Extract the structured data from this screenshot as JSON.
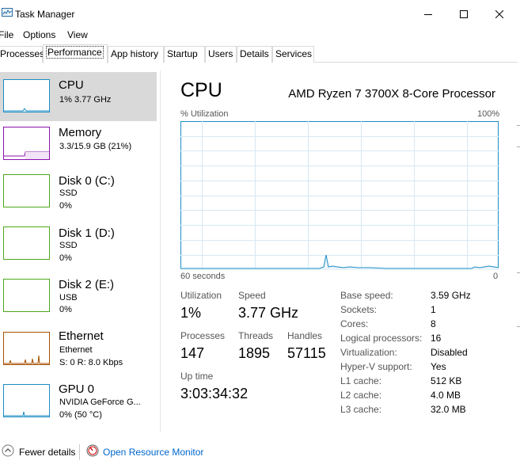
{
  "window": {
    "title": "Task Manager"
  },
  "menu": [
    "File",
    "Options",
    "View"
  ],
  "tabs": [
    "Processes",
    "Performance",
    "App history",
    "Startup",
    "Users",
    "Details",
    "Services"
  ],
  "sidebar": {
    "items": [
      {
        "title": "CPU",
        "line1": "1%  3.77 GHz",
        "line2": "",
        "color": "#1c8cc4"
      },
      {
        "title": "Memory",
        "line1": "3.3/15.9 GB (21%)",
        "line2": "",
        "color": "#8b12ae"
      },
      {
        "title": "Disk 0 (C:)",
        "line1": "SSD",
        "line2": "0%",
        "color": "#4da61b"
      },
      {
        "title": "Disk 1 (D:)",
        "line1": "SSD",
        "line2": "0%",
        "color": "#4da61b"
      },
      {
        "title": "Disk 2 (E:)",
        "line1": "USB",
        "line2": "0%",
        "color": "#4da61b"
      },
      {
        "title": "Ethernet",
        "line1": "Ethernet",
        "line2": "S: 0  R: 8.0 Kbps",
        "color": "#a74f01"
      },
      {
        "title": "GPU 0",
        "line1": "NVIDIA GeForce G...",
        "line2": "0%  (50 °C)",
        "color": "#1c8cc4"
      }
    ]
  },
  "main": {
    "title": "CPU",
    "model": "AMD Ryzen 7 3700X 8-Core Processor",
    "graph": {
      "top_left": "% Utilization",
      "top_right": "100%",
      "bottom_left": "60 seconds",
      "bottom_right": "0",
      "color": "#1c8cc4",
      "utilization_percent": [
        0,
        0,
        0,
        0,
        0,
        0,
        0,
        0,
        0,
        0,
        0,
        0,
        0,
        0,
        0,
        0,
        0,
        0,
        0,
        0,
        0,
        0,
        0,
        0,
        0,
        0,
        0,
        0,
        0,
        0,
        0,
        0,
        0,
        0,
        0,
        0,
        0,
        0,
        0,
        0,
        0,
        0,
        0,
        0,
        0,
        0,
        0,
        0,
        0,
        0,
        0,
        0,
        0,
        0,
        0,
        0,
        0,
        0,
        0,
        0,
        0,
        0,
        0,
        0,
        0,
        0,
        0,
        0,
        0,
        0,
        0,
        0,
        0,
        0,
        0,
        0,
        0,
        0,
        0,
        0,
        0,
        0,
        0,
        0,
        0,
        0,
        0,
        0,
        0,
        0,
        0,
        0,
        0,
        0,
        0,
        0,
        0,
        0,
        0,
        0
      ]
    },
    "stats": {
      "utilization_label": "Utilization",
      "utilization_value": "1%",
      "speed_label": "Speed",
      "speed_value": "3.77 GHz",
      "processes_label": "Processes",
      "processes_value": "147",
      "threads_label": "Threads",
      "threads_value": "1895",
      "handles_label": "Handles",
      "handles_value": "57115",
      "uptime_label": "Up time",
      "uptime_value": "3:03:34:32"
    },
    "specs": [
      {
        "label": "Base speed:",
        "value": "3.59 GHz"
      },
      {
        "label": "Sockets:",
        "value": "1"
      },
      {
        "label": "Cores:",
        "value": "8"
      },
      {
        "label": "Logical processors:",
        "value": "16"
      },
      {
        "label": "Virtualization:",
        "value": "Disabled"
      },
      {
        "label": "Hyper-V support:",
        "value": "Yes"
      },
      {
        "label": "L1 cache:",
        "value": "512 KB"
      },
      {
        "label": "L2 cache:",
        "value": "4.0 MB"
      },
      {
        "label": "L3 cache:",
        "value": "32.0 MB"
      }
    ]
  },
  "footer": {
    "fewer_details": "Fewer details",
    "resource_monitor": "Open Resource Monitor"
  }
}
